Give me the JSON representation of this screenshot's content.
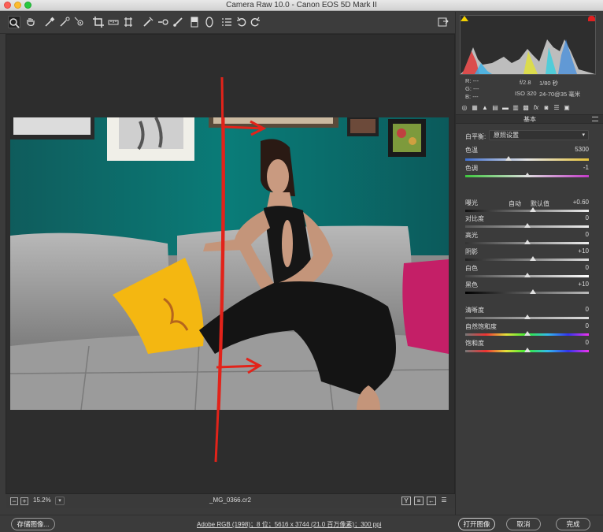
{
  "window": {
    "title": "Camera Raw 10.0 -  Canon EOS 5D Mark II"
  },
  "toolbar": {
    "tools": [
      "zoom-tool",
      "hand-tool",
      "white-balance-tool",
      "color-sampler-tool",
      "targeted-adjustment-tool",
      "crop-tool",
      "straighten-tool",
      "transform-tool",
      "spot-removal-tool",
      "red-eye-tool",
      "adjustment-brush-tool",
      "graduated-filter-tool",
      "radial-filter-tool",
      "snapshots-tool",
      "rotate-ccw-tool",
      "rotate-cw-tool"
    ],
    "fullscreen_icon": "fullscreen-toggle-icon"
  },
  "histogram": {
    "rgb": {
      "r": "R:",
      "g": "G:",
      "b": "B:",
      "r_val": "---",
      "g_val": "---",
      "b_val": "---"
    },
    "camera": {
      "aperture": "f/2.8",
      "shutter": "1/80 秒",
      "iso": "ISO 320",
      "lens": "24-70@35 毫米"
    }
  },
  "panel": {
    "section_title": "基本",
    "white_balance_label": "白平衡:",
    "white_balance_value": "原照设置",
    "auto_label": "自动",
    "default_label": "默认值",
    "sliders": {
      "temp": {
        "label": "色温",
        "value": "5300",
        "level": 0.35
      },
      "tint": {
        "label": "色调",
        "value": "-1",
        "level": 0.5
      },
      "exposure": {
        "label": "曝光",
        "value": "+0.60",
        "level": 0.55
      },
      "contrast": {
        "label": "对比度",
        "value": "0",
        "level": 0.5
      },
      "highlights": {
        "label": "高光",
        "value": "0",
        "level": 0.5
      },
      "shadows": {
        "label": "阴影",
        "value": "+10",
        "level": 0.55
      },
      "whites": {
        "label": "白色",
        "value": "0",
        "level": 0.5
      },
      "blacks": {
        "label": "黑色",
        "value": "+10",
        "level": 0.55
      },
      "clarity": {
        "label": "清晰度",
        "value": "0",
        "level": 0.5
      },
      "vibrance": {
        "label": "自然饱和度",
        "value": "0",
        "level": 0.5
      },
      "saturation": {
        "label": "饱和度",
        "value": "0",
        "level": 0.5
      }
    }
  },
  "canvas": {
    "zoom": "15.2%",
    "filename": "_MG_0366.cr2",
    "view_buttons": [
      "Y",
      "≡",
      "←",
      "☰"
    ]
  },
  "status": {
    "save_label": "存储图像...",
    "workflow": "Adobe RGB (1998)；8 位；5616 x 3744 (21.0 百万像素)；300 ppi",
    "open_label": "打开图像",
    "cancel_label": "取消",
    "done_label": "完成"
  }
}
